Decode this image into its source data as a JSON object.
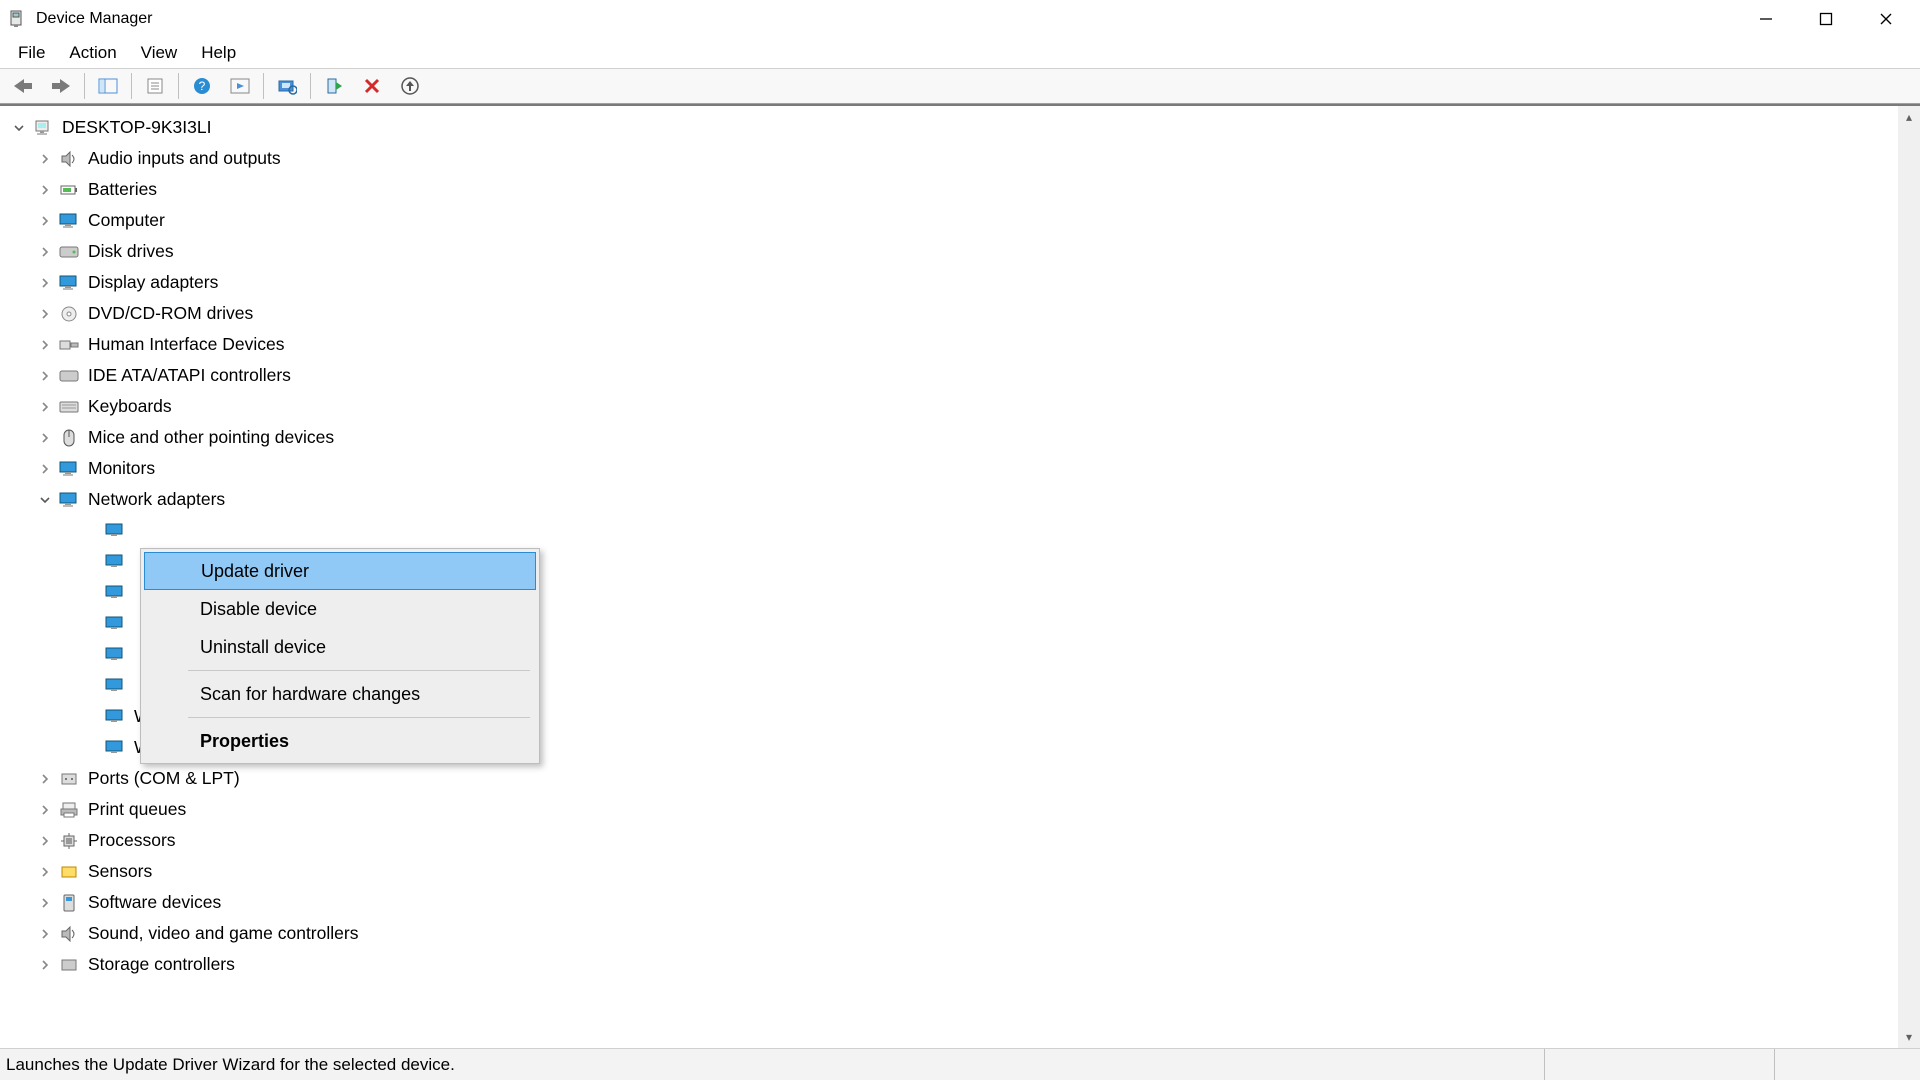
{
  "window": {
    "title": "Device Manager"
  },
  "menu": {
    "file": "File",
    "action": "Action",
    "view": "View",
    "help": "Help"
  },
  "tree": {
    "root": "DESKTOP-9K3I3LI",
    "categories": [
      "Audio inputs and outputs",
      "Batteries",
      "Computer",
      "Disk drives",
      "Display adapters",
      "DVD/CD-ROM drives",
      "Human Interface Devices",
      "IDE ATA/ATAPI controllers",
      "Keyboards",
      "Mice and other pointing devices",
      "Monitors",
      "Network adapters",
      "Ports (COM & LPT)",
      "Print queues",
      "Processors",
      "Sensors",
      "Software devices",
      "Sound, video and game controllers",
      "Storage controllers"
    ],
    "network_children_visible": [
      "WAN Miniport (PPTP)",
      "WAN Miniport (SSTP)"
    ]
  },
  "context_menu": {
    "update": "Update driver",
    "disable": "Disable device",
    "uninstall": "Uninstall device",
    "scan": "Scan for hardware changes",
    "properties": "Properties"
  },
  "status": "Launches the Update Driver Wizard for the selected device."
}
